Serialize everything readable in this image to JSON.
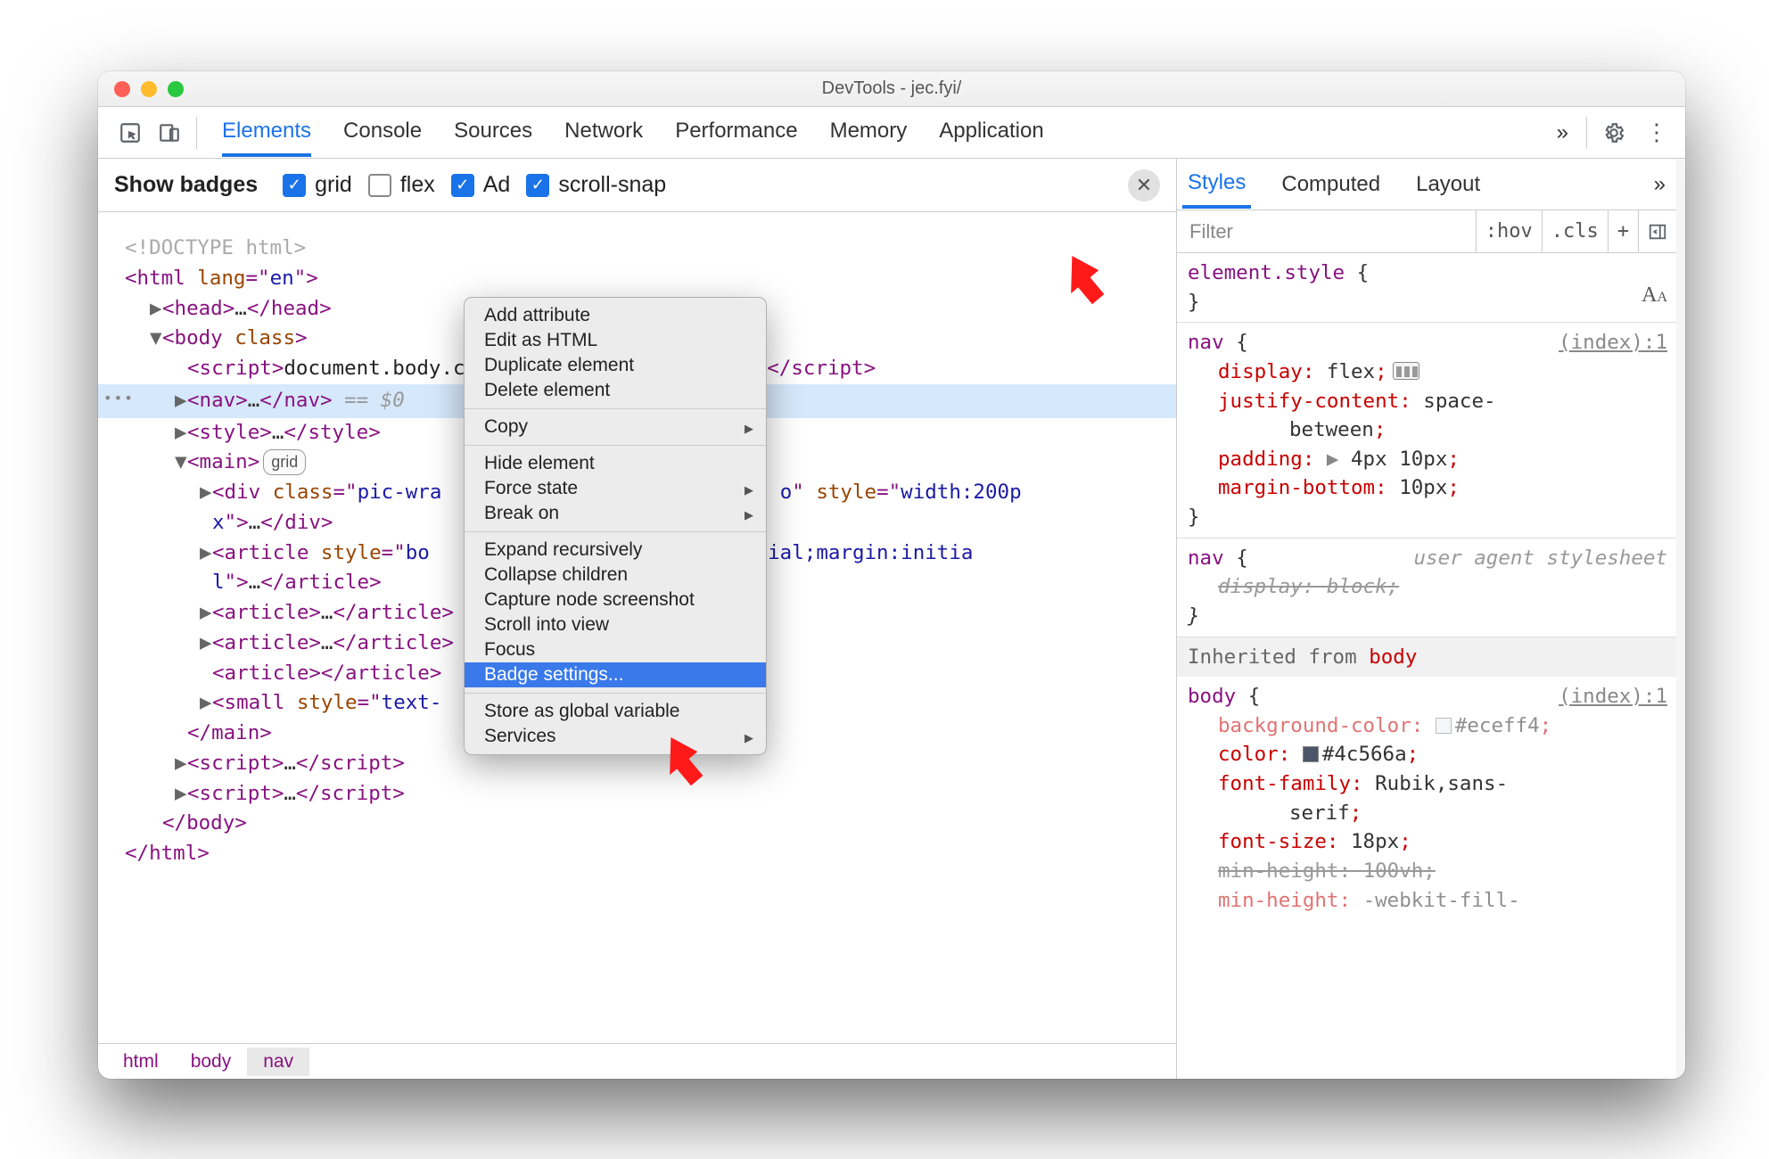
{
  "window_title": "DevTools - jec.fyi/",
  "main_tabs": [
    "Elements",
    "Console",
    "Sources",
    "Network",
    "Performance",
    "Memory",
    "Application"
  ],
  "main_tabs_more": "»",
  "badges": {
    "label": "Show badges",
    "items": [
      {
        "label": "grid",
        "checked": true
      },
      {
        "label": "flex",
        "checked": false
      },
      {
        "label": "Ad",
        "checked": true
      },
      {
        "label": "scroll-snap",
        "checked": true
      }
    ]
  },
  "dom": {
    "doctype": "<!DOCTYPE html>",
    "html_open": "<html lang=\"en\">",
    "head": {
      "open": "<head>",
      "close": "</head>",
      "collapsed": "…"
    },
    "body_open": "<body class>",
    "script_inline": "document.body.classList.toggle(\"no-js\");",
    "nav": {
      "open": "<nav>",
      "ell": "…",
      "close": "</nav>",
      "eq": "== $0"
    },
    "style": {
      "open": "<style>",
      "ell": "…",
      "close": "</style>"
    },
    "main": {
      "open": "<main>",
      "badge": "grid",
      "close": "</main>"
    },
    "div_pic": {
      "open": "<div class=\"pic-wrap",
      "mid": "o\" style=\"width:200px\">",
      "ell": "…",
      "close": "</div>"
    },
    "article1": {
      "open": "<article style=\"bo",
      "mid": "nitial;margin:initial\">",
      "ell": "…",
      "close": "</article>"
    },
    "article2": {
      "open": "<article>",
      "ell": "…",
      "close": "</article>"
    },
    "article3": {
      "open": "<article>",
      "ell": "…",
      "close": "</article>"
    },
    "article4": {
      "open": "<article>",
      "close": "</article>"
    },
    "small": {
      "open": "<small style=\"text-",
      "mid": "l\">"
    },
    "scripts": [
      {
        "open": "<script>",
        "ell": "…",
        "close": "</script>"
      },
      {
        "open": "<script>",
        "ell": "…",
        "close": "</script>"
      }
    ],
    "body_close": "</body>",
    "html_close": "</html>"
  },
  "breadcrumb": [
    "html",
    "body",
    "nav"
  ],
  "context_menu": {
    "groups": [
      [
        "Add attribute",
        "Edit as HTML",
        "Duplicate element",
        "Delete element"
      ],
      [
        {
          "label": "Copy",
          "sub": true
        }
      ],
      [
        "Hide element",
        {
          "label": "Force state",
          "sub": true
        },
        {
          "label": "Break on",
          "sub": true
        }
      ],
      [
        "Expand recursively",
        "Collapse children",
        "Capture node screenshot",
        "Scroll into view",
        "Focus",
        {
          "label": "Badge settings...",
          "selected": true
        }
      ],
      [
        "Store as global variable",
        {
          "label": "Services",
          "sub": true
        }
      ]
    ]
  },
  "styles_tabs": [
    "Styles",
    "Computed",
    "Layout"
  ],
  "styles_tabs_more": "»",
  "filter": {
    "placeholder": "Filter",
    "hov": ":hov",
    "cls": ".cls",
    "plus": "+"
  },
  "rules": {
    "element_style": {
      "sel": "element.style",
      "open": "{",
      "close": "}"
    },
    "nav": {
      "sel": "nav",
      "open": "{",
      "close": "}",
      "src": "(index):1",
      "props": [
        {
          "name": "display",
          "val": "flex",
          "icon": "flex"
        },
        {
          "name": "justify-content",
          "val": "space-between"
        },
        {
          "name": "padding",
          "val": "4px 10px",
          "caret": true
        },
        {
          "name": "margin-bottom",
          "val": "10px"
        }
      ]
    },
    "nav_ua": {
      "sel": "nav",
      "open": "{",
      "close": "}",
      "ua": "user agent stylesheet",
      "props": [
        {
          "name": "display",
          "val": "block",
          "strike": true,
          "italic": true
        }
      ]
    },
    "inherited_label": "Inherited from",
    "inherited_from": "body",
    "body": {
      "sel": "body",
      "open": "{",
      "close": "}",
      "src": "(index):1",
      "props": [
        {
          "name": "background-color",
          "val": "#eceff4",
          "swatch": "#eceff4",
          "dim": true
        },
        {
          "name": "color",
          "val": "#4c566a",
          "swatch": "#4c566a"
        },
        {
          "name": "font-family",
          "val": "Rubik,sans-serif"
        },
        {
          "name": "font-size",
          "val": "18px"
        },
        {
          "name": "min-height",
          "val": "100vh",
          "strike": true
        },
        {
          "name": "min-height",
          "val": "-webkit-fill-available",
          "dim": true,
          "partial": true
        }
      ]
    }
  }
}
